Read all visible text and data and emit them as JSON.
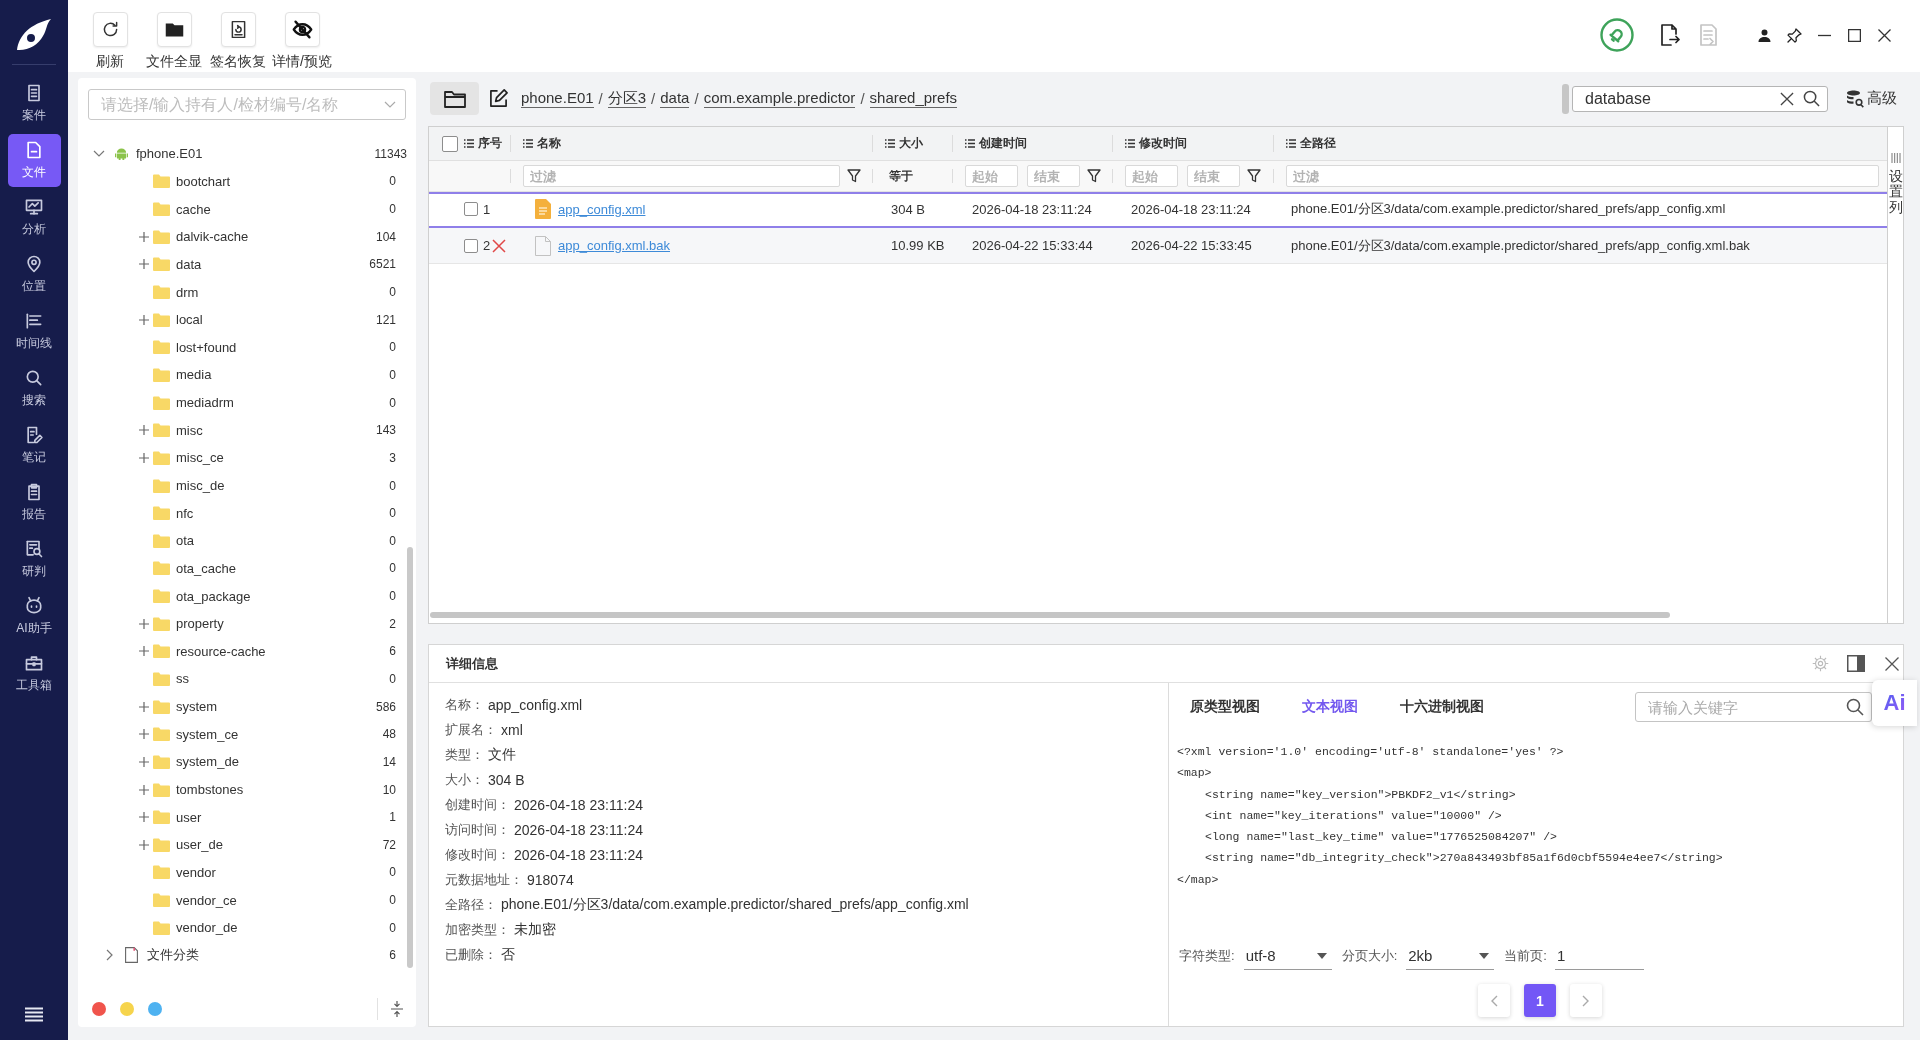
{
  "nav": {
    "items": [
      {
        "label": "案件",
        "kind": "case",
        "selected": false
      },
      {
        "label": "文件",
        "kind": "file",
        "selected": true
      },
      {
        "label": "分析",
        "kind": "analysis",
        "selected": false
      },
      {
        "label": "位置",
        "kind": "location",
        "selected": false
      },
      {
        "label": "时间线",
        "kind": "timeline",
        "selected": false
      },
      {
        "label": "搜索",
        "kind": "search",
        "selected": false
      },
      {
        "label": "笔记",
        "kind": "note",
        "selected": false
      },
      {
        "label": "报告",
        "kind": "report",
        "selected": false
      },
      {
        "label": "研判",
        "kind": "judge",
        "selected": false
      },
      {
        "label": "AI助手",
        "kind": "robot",
        "selected": false
      },
      {
        "label": "工具箱",
        "kind": "toolbox",
        "selected": false
      }
    ]
  },
  "toolbar": {
    "buttons": [
      {
        "label": "刷新",
        "kind": "refresh"
      },
      {
        "label": "文件全显",
        "kind": "folder"
      },
      {
        "label": "签名恢复",
        "kind": "restore"
      },
      {
        "label": "详情/预览",
        "kind": "hide"
      }
    ]
  },
  "title_actions": [
    {
      "kind": "bell",
      "disabled": false
    },
    {
      "kind": "export",
      "disabled": false
    },
    {
      "kind": "report",
      "disabled": true
    },
    {
      "kind": "user",
      "disabled": false
    },
    {
      "kind": "pin",
      "disabled": false
    }
  ],
  "tree": {
    "combo": {
      "placeholder": "请选择/输入持有人/检材编号/名称"
    },
    "root": {
      "label": "fphone.E01",
      "count": "11343",
      "expanded": true,
      "children": [
        {
          "label": "bootchart",
          "count": "0",
          "expandable": false
        },
        {
          "label": "cache",
          "count": "0",
          "expandable": false
        },
        {
          "label": "dalvik-cache",
          "count": "104",
          "expandable": true
        },
        {
          "label": "data",
          "count": "6521",
          "expandable": true
        },
        {
          "label": "drm",
          "count": "0",
          "expandable": false
        },
        {
          "label": "local",
          "count": "121",
          "expandable": true
        },
        {
          "label": "lost+found",
          "count": "0",
          "expandable": false
        },
        {
          "label": "media",
          "count": "0",
          "expandable": false
        },
        {
          "label": "mediadrm",
          "count": "0",
          "expandable": false
        },
        {
          "label": "misc",
          "count": "143",
          "expandable": true
        },
        {
          "label": "misc_ce",
          "count": "3",
          "expandable": true
        },
        {
          "label": "misc_de",
          "count": "0",
          "expandable": false
        },
        {
          "label": "nfc",
          "count": "0",
          "expandable": false
        },
        {
          "label": "ota",
          "count": "0",
          "expandable": false
        },
        {
          "label": "ota_cache",
          "count": "0",
          "expandable": false
        },
        {
          "label": "ota_package",
          "count": "0",
          "expandable": false
        },
        {
          "label": "property",
          "count": "2",
          "expandable": true
        },
        {
          "label": "resource-cache",
          "count": "6",
          "expandable": true
        },
        {
          "label": "ss",
          "count": "0",
          "expandable": false
        },
        {
          "label": "system",
          "count": "586",
          "expandable": true
        },
        {
          "label": "system_ce",
          "count": "48",
          "expandable": true
        },
        {
          "label": "system_de",
          "count": "14",
          "expandable": true
        },
        {
          "label": "tombstones",
          "count": "10",
          "expandable": true
        },
        {
          "label": "user",
          "count": "1",
          "expandable": true
        },
        {
          "label": "user_de",
          "count": "72",
          "expandable": true
        },
        {
          "label": "vendor",
          "count": "0",
          "expandable": false
        },
        {
          "label": "vendor_ce",
          "count": "0",
          "expandable": false
        },
        {
          "label": "vendor_de",
          "count": "0",
          "expandable": false
        }
      ]
    },
    "category": {
      "label": "文件分类",
      "count": "6",
      "expanded": false
    },
    "color_tags": [
      {
        "color": "#f0544c"
      },
      {
        "color": "#f6d44c"
      },
      {
        "color": "#4eb2f1"
      }
    ]
  },
  "path_bar": {
    "crumbs": [
      "phone.E01",
      "分区3",
      "data",
      "com.example.predictor",
      "shared_prefs"
    ],
    "separator": "/",
    "search": {
      "value": "database"
    },
    "advanced": {
      "label": "高级"
    }
  },
  "table": {
    "header_checked": false,
    "columns": [
      {
        "label": "序号"
      },
      {
        "label": "名称",
        "filter": {
          "kind": "text",
          "placeholder": "过滤",
          "funnel": true
        }
      },
      {
        "label": "大小",
        "filter": {
          "kind": "label",
          "text": "等于"
        }
      },
      {
        "label": "创建时间",
        "filter": {
          "kind": "range",
          "start": {
            "placeholder": "起始"
          },
          "end": {
            "placeholder": "结束"
          }
        }
      },
      {
        "label": "修改时间",
        "filter": {
          "kind": "range",
          "start": {
            "placeholder": "起始"
          },
          "end": {
            "placeholder": "结束"
          }
        }
      },
      {
        "label": "全路径",
        "filter": {
          "kind": "text",
          "placeholder": "过滤",
          "funnel": false
        }
      }
    ],
    "rows": [
      {
        "index": "1",
        "checked": false,
        "selected": true,
        "deleted": false,
        "kind": "xml",
        "name": "app_config.xml",
        "size": "304 B",
        "created": "2026-04-18 23:11:24",
        "modified": "2026-04-18 23:11:24",
        "path": "phone.E01/分区3/data/com.example.predictor/shared_prefs/app_config.xml"
      },
      {
        "index": "2",
        "checked": false,
        "selected": false,
        "deleted": true,
        "kind": "file",
        "name": "app_config.xml.bak",
        "size": "10.99 KB",
        "created": "2026-04-22 15:33:44",
        "modified": "2026-04-22 15:33:45",
        "path": "phone.E01/分区3/data/com.example.predictor/shared_prefs/app_config.xml.bak"
      }
    ],
    "settings_label": "设置列"
  },
  "details": {
    "title": "详细信息",
    "fields": [
      {
        "label": "名称：",
        "value": "app_config.xml"
      },
      {
        "label": "扩展名：",
        "value": "xml"
      },
      {
        "label": "类型：",
        "value": "文件"
      },
      {
        "label": "大小：",
        "value": "304 B"
      },
      {
        "label": "创建时间：",
        "value": "2026-04-18 23:11:24"
      },
      {
        "label": "访问时间：",
        "value": "2026-04-18 23:11:24"
      },
      {
        "label": "修改时间：",
        "value": "2026-04-18 23:11:24"
      },
      {
        "label": "元数据地址：",
        "value": "918074"
      },
      {
        "label": "全路径：",
        "value": "phone.E01/分区3/data/com.example.predictor/shared_prefs/app_config.xml"
      },
      {
        "label": "加密类型：",
        "value": "未加密"
      },
      {
        "label": "已删除：",
        "value": "否"
      }
    ]
  },
  "viewer": {
    "tabs": [
      {
        "label": "原类型视图",
        "selected": false
      },
      {
        "label": "文本视图",
        "selected": true
      },
      {
        "label": "十六进制视图",
        "selected": false
      }
    ],
    "search": {
      "placeholder": "请输入关键字"
    },
    "ai_badge": "Ai",
    "lines": [
      {
        "text": "<?xml version='1.0' encoding='utf-8' standalone='yes' ?>"
      },
      {
        "text": "<map>",
        "children": [
          {
            "text": "<string name=\"key_version\">PBKDF2_v1</string>"
          },
          {
            "text": "<int name=\"key_iterations\" value=\"10000\" />"
          },
          {
            "text": "<long name=\"last_key_time\" value=\"1776525084207\" />"
          },
          {
            "text": "<string name=\"db_integrity_check\">270a843493bf85a1f6d0cbf5594e4ee7</string>"
          }
        ]
      },
      {
        "text": "</map>"
      }
    ],
    "charset": {
      "label": "字符类型:",
      "value": "utf-8"
    },
    "page_size": {
      "label": "分页大小:",
      "value": "2kb"
    },
    "current_page": {
      "label": "当前页:",
      "value": "1"
    },
    "pages": [
      {
        "label": "1",
        "selected": true
      }
    ]
  }
}
